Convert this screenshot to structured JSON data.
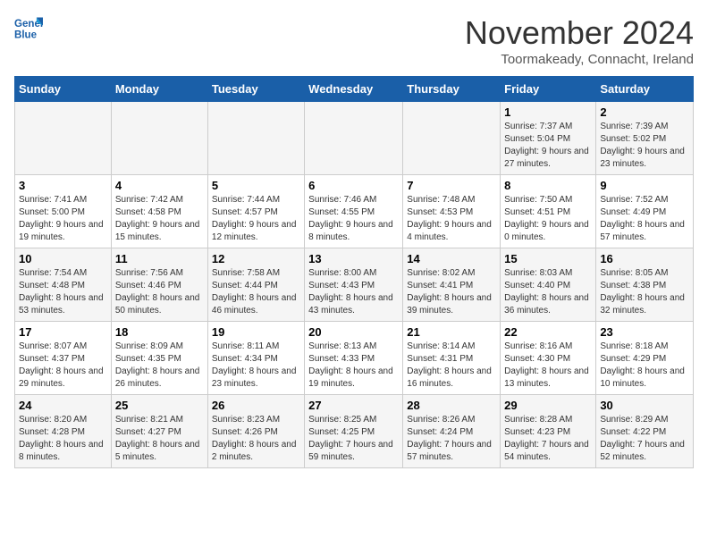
{
  "logo": {
    "line1": "General",
    "line2": "Blue"
  },
  "title": "November 2024",
  "subtitle": "Toormakeady, Connacht, Ireland",
  "weekdays": [
    "Sunday",
    "Monday",
    "Tuesday",
    "Wednesday",
    "Thursday",
    "Friday",
    "Saturday"
  ],
  "weeks": [
    [
      {
        "day": "",
        "info": ""
      },
      {
        "day": "",
        "info": ""
      },
      {
        "day": "",
        "info": ""
      },
      {
        "day": "",
        "info": ""
      },
      {
        "day": "",
        "info": ""
      },
      {
        "day": "1",
        "info": "Sunrise: 7:37 AM\nSunset: 5:04 PM\nDaylight: 9 hours and 27 minutes."
      },
      {
        "day": "2",
        "info": "Sunrise: 7:39 AM\nSunset: 5:02 PM\nDaylight: 9 hours and 23 minutes."
      }
    ],
    [
      {
        "day": "3",
        "info": "Sunrise: 7:41 AM\nSunset: 5:00 PM\nDaylight: 9 hours and 19 minutes."
      },
      {
        "day": "4",
        "info": "Sunrise: 7:42 AM\nSunset: 4:58 PM\nDaylight: 9 hours and 15 minutes."
      },
      {
        "day": "5",
        "info": "Sunrise: 7:44 AM\nSunset: 4:57 PM\nDaylight: 9 hours and 12 minutes."
      },
      {
        "day": "6",
        "info": "Sunrise: 7:46 AM\nSunset: 4:55 PM\nDaylight: 9 hours and 8 minutes."
      },
      {
        "day": "7",
        "info": "Sunrise: 7:48 AM\nSunset: 4:53 PM\nDaylight: 9 hours and 4 minutes."
      },
      {
        "day": "8",
        "info": "Sunrise: 7:50 AM\nSunset: 4:51 PM\nDaylight: 9 hours and 0 minutes."
      },
      {
        "day": "9",
        "info": "Sunrise: 7:52 AM\nSunset: 4:49 PM\nDaylight: 8 hours and 57 minutes."
      }
    ],
    [
      {
        "day": "10",
        "info": "Sunrise: 7:54 AM\nSunset: 4:48 PM\nDaylight: 8 hours and 53 minutes."
      },
      {
        "day": "11",
        "info": "Sunrise: 7:56 AM\nSunset: 4:46 PM\nDaylight: 8 hours and 50 minutes."
      },
      {
        "day": "12",
        "info": "Sunrise: 7:58 AM\nSunset: 4:44 PM\nDaylight: 8 hours and 46 minutes."
      },
      {
        "day": "13",
        "info": "Sunrise: 8:00 AM\nSunset: 4:43 PM\nDaylight: 8 hours and 43 minutes."
      },
      {
        "day": "14",
        "info": "Sunrise: 8:02 AM\nSunset: 4:41 PM\nDaylight: 8 hours and 39 minutes."
      },
      {
        "day": "15",
        "info": "Sunrise: 8:03 AM\nSunset: 4:40 PM\nDaylight: 8 hours and 36 minutes."
      },
      {
        "day": "16",
        "info": "Sunrise: 8:05 AM\nSunset: 4:38 PM\nDaylight: 8 hours and 32 minutes."
      }
    ],
    [
      {
        "day": "17",
        "info": "Sunrise: 8:07 AM\nSunset: 4:37 PM\nDaylight: 8 hours and 29 minutes."
      },
      {
        "day": "18",
        "info": "Sunrise: 8:09 AM\nSunset: 4:35 PM\nDaylight: 8 hours and 26 minutes."
      },
      {
        "day": "19",
        "info": "Sunrise: 8:11 AM\nSunset: 4:34 PM\nDaylight: 8 hours and 23 minutes."
      },
      {
        "day": "20",
        "info": "Sunrise: 8:13 AM\nSunset: 4:33 PM\nDaylight: 8 hours and 19 minutes."
      },
      {
        "day": "21",
        "info": "Sunrise: 8:14 AM\nSunset: 4:31 PM\nDaylight: 8 hours and 16 minutes."
      },
      {
        "day": "22",
        "info": "Sunrise: 8:16 AM\nSunset: 4:30 PM\nDaylight: 8 hours and 13 minutes."
      },
      {
        "day": "23",
        "info": "Sunrise: 8:18 AM\nSunset: 4:29 PM\nDaylight: 8 hours and 10 minutes."
      }
    ],
    [
      {
        "day": "24",
        "info": "Sunrise: 8:20 AM\nSunset: 4:28 PM\nDaylight: 8 hours and 8 minutes."
      },
      {
        "day": "25",
        "info": "Sunrise: 8:21 AM\nSunset: 4:27 PM\nDaylight: 8 hours and 5 minutes."
      },
      {
        "day": "26",
        "info": "Sunrise: 8:23 AM\nSunset: 4:26 PM\nDaylight: 8 hours and 2 minutes."
      },
      {
        "day": "27",
        "info": "Sunrise: 8:25 AM\nSunset: 4:25 PM\nDaylight: 7 hours and 59 minutes."
      },
      {
        "day": "28",
        "info": "Sunrise: 8:26 AM\nSunset: 4:24 PM\nDaylight: 7 hours and 57 minutes."
      },
      {
        "day": "29",
        "info": "Sunrise: 8:28 AM\nSunset: 4:23 PM\nDaylight: 7 hours and 54 minutes."
      },
      {
        "day": "30",
        "info": "Sunrise: 8:29 AM\nSunset: 4:22 PM\nDaylight: 7 hours and 52 minutes."
      }
    ]
  ]
}
